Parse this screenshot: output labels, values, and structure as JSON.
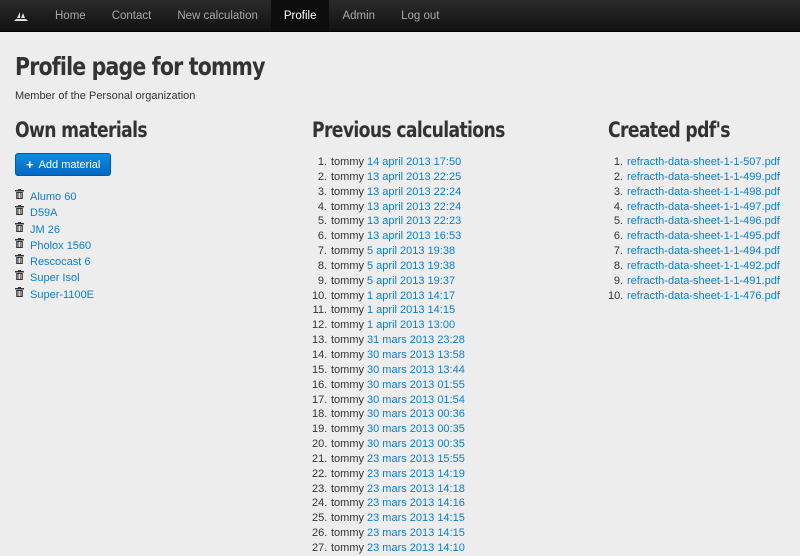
{
  "nav": {
    "brand_icon": "ship-icon",
    "items": [
      {
        "label": "Home",
        "active": false
      },
      {
        "label": "Contact",
        "active": false
      },
      {
        "label": "New calculation",
        "active": false
      },
      {
        "label": "Profile",
        "active": true
      },
      {
        "label": "Admin",
        "active": false
      },
      {
        "label": "Log out",
        "active": false
      }
    ]
  },
  "page": {
    "title": "Profile page for tommy",
    "subtitle": "Member of the Personal organization"
  },
  "materials": {
    "heading": "Own materials",
    "add_button": "Add material",
    "items": [
      "Alumo 60",
      "D59A",
      "JM 26",
      "Pholox 1560",
      "Rescocast 6",
      "Super Isol",
      "Super-1100E"
    ]
  },
  "calculations": {
    "heading": "Previous calculations",
    "user": "tommy",
    "items": [
      "14 april 2013 17:50",
      "13 april 2013 22:25",
      "13 april 2013 22:24",
      "13 april 2013 22:24",
      "13 april 2013 22:23",
      "13 april 2013 16:53",
      "5 april 2013 19:38",
      "5 april 2013 19:38",
      "5 april 2013 19:37",
      "1 april 2013 14:17",
      "1 april 2013 14:15",
      "1 april 2013 13:00",
      "31 mars 2013 23:28",
      "30 mars 2013 13:58",
      "30 mars 2013 13:44",
      "30 mars 2013 01:55",
      "30 mars 2013 01:54",
      "30 mars 2013 00:36",
      "30 mars 2013 00:35",
      "30 mars 2013 00:35",
      "23 mars 2013 15:55",
      "23 mars 2013 14:19",
      "23 mars 2013 14:18",
      "23 mars 2013 14:16",
      "23 mars 2013 14:15",
      "23 mars 2013 14:15",
      "23 mars 2013 14:10"
    ]
  },
  "pdfs": {
    "heading": "Created pdf's",
    "items": [
      "refracth-data-sheet-1-1-507.pdf",
      "refracth-data-sheet-1-1-499.pdf",
      "refracth-data-sheet-1-1-498.pdf",
      "refracth-data-sheet-1-1-497.pdf",
      "refracth-data-sheet-1-1-496.pdf",
      "refracth-data-sheet-1-1-495.pdf",
      "refracth-data-sheet-1-1-494.pdf",
      "refracth-data-sheet-1-1-492.pdf",
      "refracth-data-sheet-1-1-491.pdf",
      "refracth-data-sheet-1-1-476.pdf"
    ]
  }
}
